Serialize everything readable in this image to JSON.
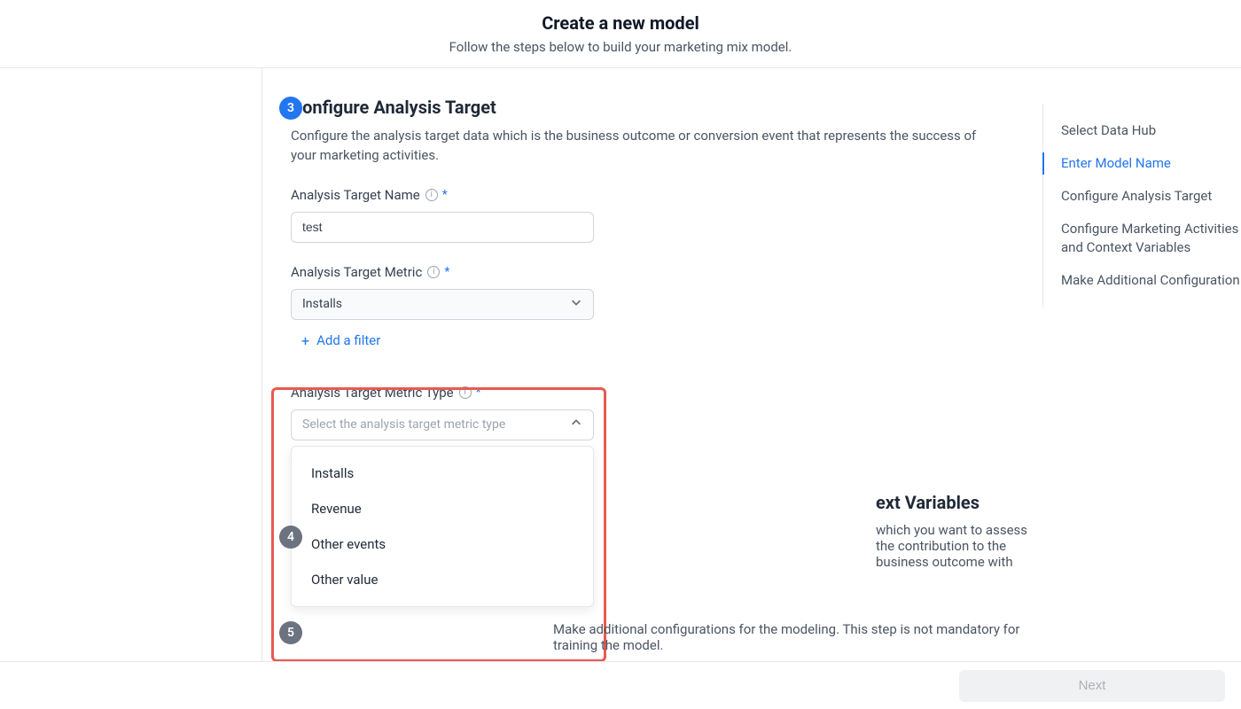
{
  "header": {
    "title": "Create a new model",
    "subtitle": "Follow the steps below to build your marketing mix model."
  },
  "step3": {
    "num": "3",
    "title": "Configure Analysis Target",
    "desc": "Configure the analysis target data which is the business outcome or conversion event that represents the success of your marketing activities.",
    "name_label": "Analysis Target Name",
    "name_value": "test",
    "metric_label": "Analysis Target Metric",
    "metric_value": "Installs",
    "add_filter": "Add a filter",
    "metric_type_label": "Analysis Target Metric Type",
    "metric_type_placeholder": "Select the analysis target metric type",
    "metric_type_options": [
      "Installs",
      "Revenue",
      "Other events",
      "Other value"
    ]
  },
  "step4": {
    "num": "4",
    "title_suffix": "ext Variables",
    "desc_suffix": "which you want to assess the contribution to the business outcome with"
  },
  "step5": {
    "num": "5",
    "desc": "Make additional configurations for the modeling. This step is not mandatory for training the model."
  },
  "sidenav": {
    "items": [
      {
        "label": "Select Data Hub",
        "active": false
      },
      {
        "label": "Enter Model Name",
        "active": true
      },
      {
        "label": "Configure Analysis Target",
        "active": false
      },
      {
        "label": "Configure Marketing Activities and Context Variables",
        "active": false
      },
      {
        "label": "Make Additional Configuration",
        "active": false
      }
    ]
  },
  "footer": {
    "next": "Next"
  }
}
